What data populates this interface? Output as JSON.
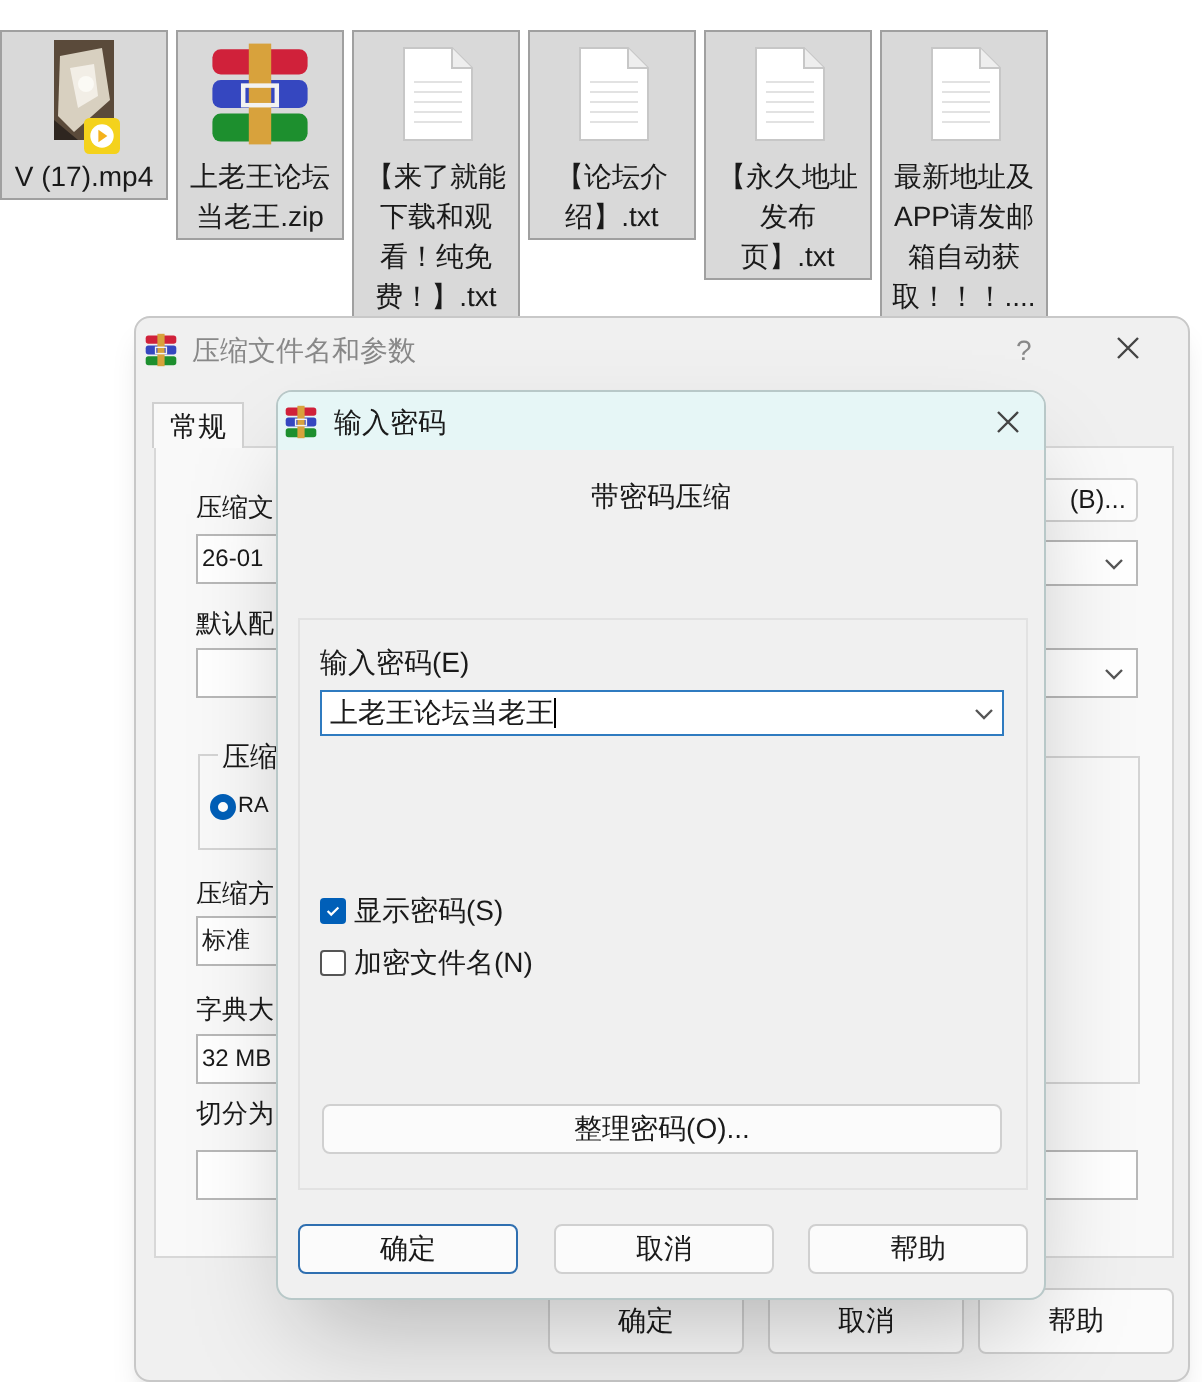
{
  "desktop_files": [
    {
      "kind": "video",
      "name": "V (17).mp4",
      "selected": true
    },
    {
      "kind": "archive",
      "name": "上老王论坛当老王.zip",
      "selected": true
    },
    {
      "kind": "text",
      "name": "【来了就能下载和观看！纯免费！】.txt",
      "selected": true
    },
    {
      "kind": "text",
      "name": "【论坛介绍】.txt",
      "selected": true
    },
    {
      "kind": "text",
      "name": "【永久地址发布页】.txt",
      "selected": true
    },
    {
      "kind": "text",
      "name": "最新地址及APP请发邮箱自动获取！！！....",
      "selected": true
    }
  ],
  "archive_dialog": {
    "title": "压缩文件名和参数",
    "help": "?",
    "tabs": [
      {
        "label": "常规",
        "selected": true
      }
    ],
    "left_items": [
      {
        "kind": "label",
        "text": "压缩文"
      },
      {
        "kind": "field",
        "value": "26-01"
      },
      {
        "kind": "label",
        "text": "默认配"
      },
      {
        "kind": "field"
      },
      {
        "kind": "group",
        "legend": "压缩",
        "radio": {
          "label": "RA",
          "selected": true
        }
      },
      {
        "kind": "label",
        "text": "压缩方"
      },
      {
        "kind": "field",
        "value": "标准"
      },
      {
        "kind": "label",
        "text": "字典大"
      },
      {
        "kind": "field",
        "value": "32 MB"
      },
      {
        "kind": "label",
        "text": "切分为"
      },
      {
        "kind": "field"
      }
    ],
    "browse_button": "(B)...",
    "buttons": [
      "确定",
      "取消",
      "帮助"
    ]
  },
  "password_dialog": {
    "title": "输入密码",
    "heading": "带密码压缩",
    "password_label": "输入密码(E)",
    "password_value": "上老王论坛当老王",
    "options": [
      {
        "label": "显示密码(S)",
        "checked": true
      },
      {
        "label": "加密文件名(N)",
        "checked": false
      }
    ],
    "organize_button": "整理密码(O)...",
    "buttons": [
      {
        "label": "确定",
        "default": true
      },
      {
        "label": "取消",
        "default": false
      },
      {
        "label": "帮助",
        "default": false
      }
    ]
  }
}
